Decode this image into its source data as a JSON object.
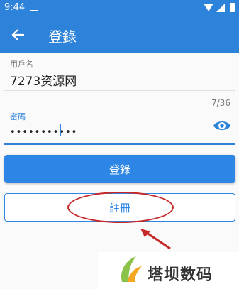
{
  "status_bar": {
    "time": "9:44"
  },
  "app_bar": {
    "title": "登錄",
    "back_icon": "arrow-left-icon"
  },
  "form": {
    "username": {
      "label": "用戶名",
      "value": "7273资源网"
    },
    "password": {
      "label": "密碼",
      "masked_value": "•••••••••••",
      "counter": "7/36",
      "toggle_icon": "eye-icon"
    }
  },
  "buttons": {
    "login": "登錄",
    "register": "註冊"
  },
  "watermark": {
    "text": "塔坝数码"
  },
  "colors": {
    "primary": "#2d82da",
    "annotation": "#c62828"
  }
}
